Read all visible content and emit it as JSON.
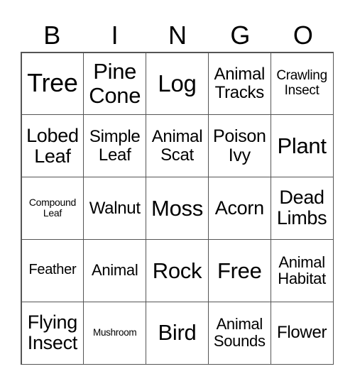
{
  "header": [
    "B",
    "I",
    "N",
    "G",
    "O"
  ],
  "cells": [
    [
      "Tree",
      "Pine\nCone",
      "Log",
      "Animal\nTracks",
      "Crawling\nInsect"
    ],
    [
      "Lobed\nLeaf",
      "Simple\nLeaf",
      "Animal\nScat",
      "Poison\nIvy",
      "Plant"
    ],
    [
      "Compound\nLeaf",
      "Walnut",
      "Moss",
      "Acorn",
      "Dead\nLimbs"
    ],
    [
      "Feather",
      "Animal",
      "Rock",
      "Free",
      "Animal\nHabitat"
    ],
    [
      "Flying\nInsect",
      "Mushroom",
      "Bird",
      "Animal\nSounds",
      "Flower"
    ]
  ]
}
